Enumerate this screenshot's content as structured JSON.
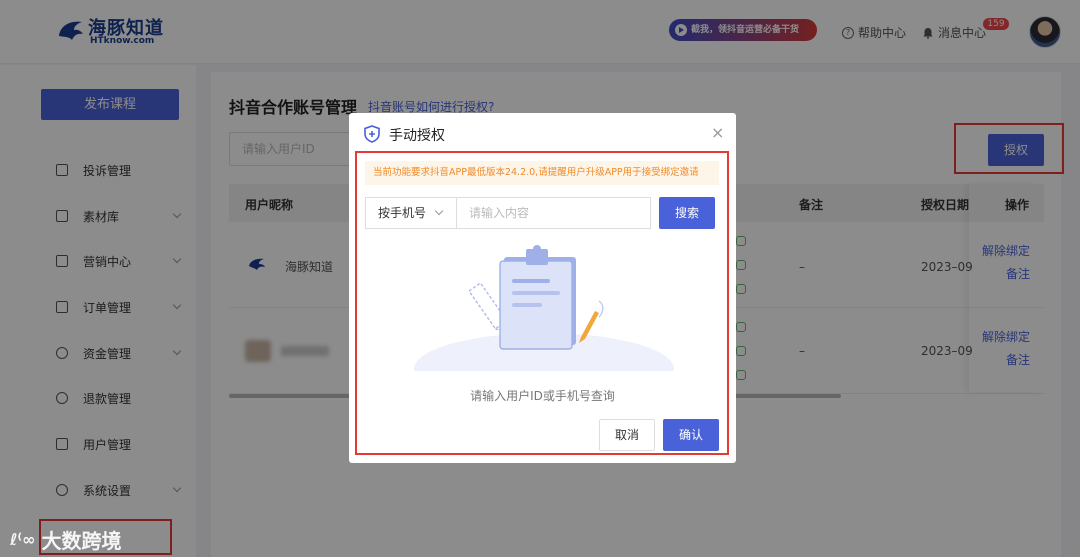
{
  "header": {
    "logo_text": "海豚知道",
    "logo_sub": "HTknow.com",
    "promo": "截我，领抖音运营必备干货",
    "help": "帮助中心",
    "messages": "消息中心",
    "message_count": "159"
  },
  "sidebar": {
    "publish": "发布课程",
    "items": [
      {
        "label": "投诉管理"
      },
      {
        "label": "素材库"
      },
      {
        "label": "营销中心"
      },
      {
        "label": "订单管理"
      },
      {
        "label": "资金管理"
      },
      {
        "label": "退款管理"
      },
      {
        "label": "用户管理"
      },
      {
        "label": "系统设置"
      }
    ]
  },
  "main": {
    "title": "抖音合作账号管理",
    "help_link": "抖音账号如何进行授权?",
    "uid_placeholder": "请输入用户ID",
    "auth_button": "授权",
    "columns": [
      "用户昵称",
      "备注",
      "授权日期",
      "操作"
    ],
    "rows": [
      {
        "nickname": "海豚知道",
        "remark": "–",
        "date": "2023–09",
        "unbind": "解除绑定",
        "note": "备注"
      },
      {
        "nickname": "",
        "remark": "–",
        "date": "2023–09",
        "unbind": "解除绑定",
        "note": "备注"
      }
    ]
  },
  "dialog": {
    "title": "手动授权",
    "notice": "当前功能要求抖音APP最低版本24.2.0,请提醒用户升级APP用于接受绑定邀请",
    "type_select": "按手机号",
    "content_placeholder": "请输入内容",
    "search": "搜索",
    "empty_text": "请输入用户ID或手机号查询",
    "cancel": "取消",
    "confirm": "确认"
  },
  "watermark": {
    "mark": "ℓ⁽∞",
    "text": "大数跨境"
  },
  "colors": {
    "accent": "#4a62d9",
    "highlight": "#e53935",
    "notice_bg": "#fdf5e8",
    "notice_text": "#f08a2a"
  }
}
